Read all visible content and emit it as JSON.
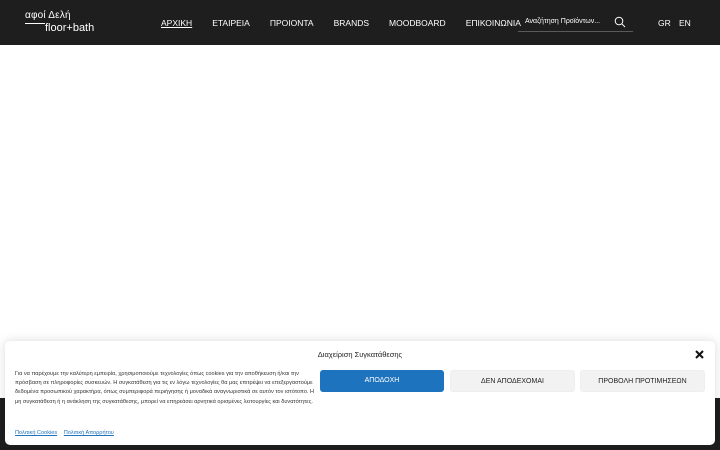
{
  "brand": {
    "logo_top": "αφοί Δελή",
    "logo_bottom": "floor+bath"
  },
  "nav": {
    "items": [
      {
        "label": "ΑΡΧΙΚΗ"
      },
      {
        "label": "ΕΤΑΙΡΕΙΑ"
      },
      {
        "label": "ΠΡΟΙΟΝΤΑ"
      },
      {
        "label": "BRANDS"
      },
      {
        "label": "MOODBOARD"
      },
      {
        "label": "ΕΠΙΚΟΙΝΩΝΙΑ"
      }
    ]
  },
  "search": {
    "placeholder": "Αναζήτηση Προϊόντων...",
    "icon": "search-icon"
  },
  "languages": {
    "gr": "GR",
    "en": "EN"
  },
  "consent": {
    "title": "Διαχείριση Συγκατάθεσης",
    "text": "Για να παρέχουμε την καλύτερη εμπειρία, χρησιμοποιούμε τεχνολογίες όπως cookies για την αποθήκευση ή/και την πρόσβαση σε πληροφορίες συσκευών. Η συγκατάθεση για τις εν λόγω τεχνολογίες θα μας επιτρέψει να επεξεργαστούμε δεδομένα προσωπικού χαρακτήρα, όπως συμπεριφορά περιήγησης ή μοναδικά αναγνωριστικά σε αυτόν τον ιστότοπο. Η μη συγκατάθεση ή η ανάκληση της συγκατάθεσης, μπορεί να επηρεάσει αρνητικά ορισμένες λειτουργίες και δυνατότητες.",
    "accept_label": "ΑΠΟΔΟΧΗ",
    "deny_label": "ΔΕΝ ΑΠΟΔΕΧΟΜΑΙ",
    "prefs_label": "ΠΡΟΒΟΛΗ ΠΡΟΤΙΜΗΣΕΩΝ",
    "links": {
      "cookies": "Πολιτική Cookies",
      "privacy": "Πολιτική Απορρήτου"
    }
  },
  "colors": {
    "header_bg": "#1e1e1e",
    "accent": "#1e73be",
    "secondary_button_bg": "#f2f2f2"
  }
}
